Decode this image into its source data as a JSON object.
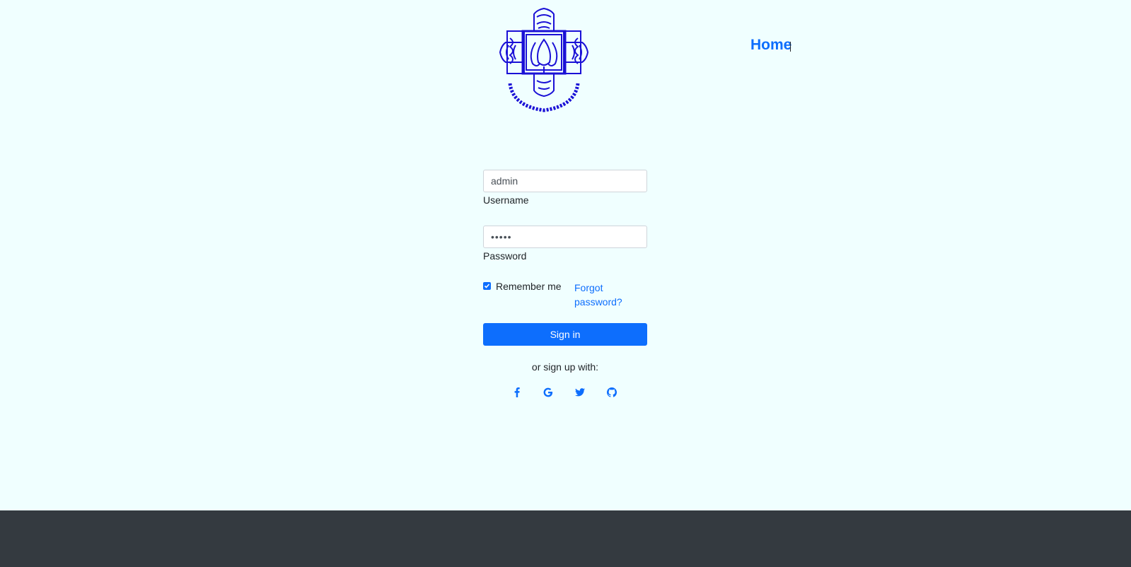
{
  "header": {
    "logo_alt": "Jahangirnagar University logo",
    "logo_text": "জাহাঙ্গীরনগর বিশ্ববিদ্যালয়",
    "nav_home": "Home"
  },
  "login": {
    "username_value": "admin",
    "username_label": "Username",
    "password_value": "•••••",
    "password_label": "Password",
    "remember_label": "Remember me",
    "remember_checked": true,
    "forgot_label": "Forgot password?",
    "signin_label": "Sign in",
    "signup_text": "or sign up with:",
    "social_icons": [
      "facebook-icon",
      "google-icon",
      "twitter-icon",
      "github-icon"
    ]
  },
  "colors": {
    "background": "#f0ffff",
    "accent": "#0d6efd",
    "footer": "#343a40",
    "logo": "#1a10d6"
  }
}
